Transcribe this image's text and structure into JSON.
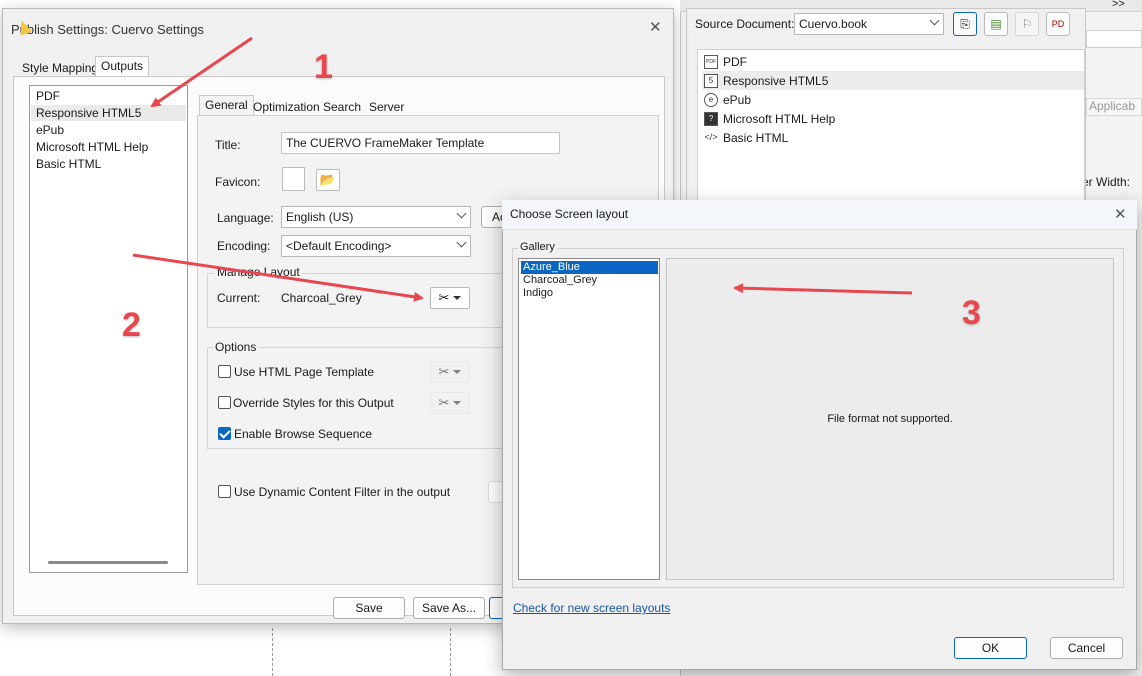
{
  "publish_dialog": {
    "title": "Publish Settings: Cuervo Settings",
    "tabs": [
      "Style Mapping",
      "Outputs"
    ],
    "outputs": [
      "PDF",
      "Responsive HTML5",
      "ePub",
      "Microsoft HTML Help",
      "Basic HTML"
    ],
    "subtabs": [
      "General",
      "Optimization",
      "Search",
      "Server"
    ],
    "title_label": "Title:",
    "title_value": "The CUERVO FrameMaker Template",
    "favicon_label": "Favicon:",
    "language_label": "Language:",
    "language_value": "English (US)",
    "add_btn_partial": "Ac",
    "encoding_label": "Encoding:",
    "encoding_value": "<Default Encoding>",
    "layout_group": "Manage Layout",
    "current_label": "Current:",
    "current_value": "Charcoal_Grey",
    "options_group": "Options",
    "opt_html_template": "Use HTML Page Template",
    "opt_override_styles": "Override Styles for this Output",
    "opt_browse_sequence": "Enable Browse Sequence",
    "opt_dynamic_filter": "Use Dynamic Content Filter in the output",
    "save_btn": "Save",
    "save_as_btn": "Save As..."
  },
  "source_panel": {
    "label": "Source Document:",
    "value": "Cuervo.book",
    "items": [
      "PDF",
      "Responsive HTML5",
      "ePub",
      "Microsoft HTML Help",
      "Basic HTML"
    ],
    "item_icons": [
      "PDF",
      "5",
      "e",
      "?",
      "</>"
    ],
    "side_fragment_1": "Applicab",
    "side_fragment_2": "er Width:",
    "top_fragment": ">>"
  },
  "layout_dialog": {
    "title": "Choose Screen layout",
    "gallery_label": "Gallery",
    "layouts": [
      "Azure_Blue",
      "Charcoal_Grey",
      "Indigo"
    ],
    "selected": "Azure_Blue",
    "preview_message": "File format not supported.",
    "check_link": "Check for new screen layouts",
    "ok": "OK",
    "cancel": "Cancel"
  },
  "annotations": [
    "1",
    "2",
    "3"
  ],
  "colors": {
    "arrow": "#e8474f",
    "selection": "#0a66c2",
    "link": "#1a55a5"
  }
}
